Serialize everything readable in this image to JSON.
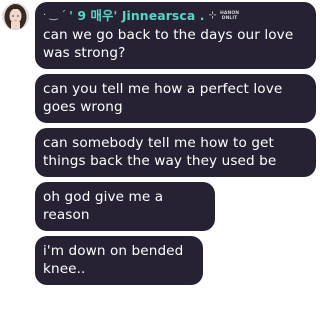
{
  "header": {
    "decoration": "· ‿ ˊ",
    "username": "' 9 매우' Jinnearsca .",
    "sparkle": "⊹",
    "tag_line1": "HANON",
    "tag_line2": "DNLIT"
  },
  "messages": [
    {
      "text": "can we go back to the days our love was strong?"
    },
    {
      "text": "can you tell me how a perfect love goes wrong"
    },
    {
      "text": "can somebody tell me how to get things back the way they used be"
    },
    {
      "text": "oh god give me a reason"
    },
    {
      "text": "i'm down on bended knee.."
    }
  ],
  "colors": {
    "bubble": "#262234",
    "username": "#55d6c7",
    "text": "#ffffff",
    "background": "#ffffff"
  },
  "icons": {
    "avatar": "user-avatar-photo"
  }
}
